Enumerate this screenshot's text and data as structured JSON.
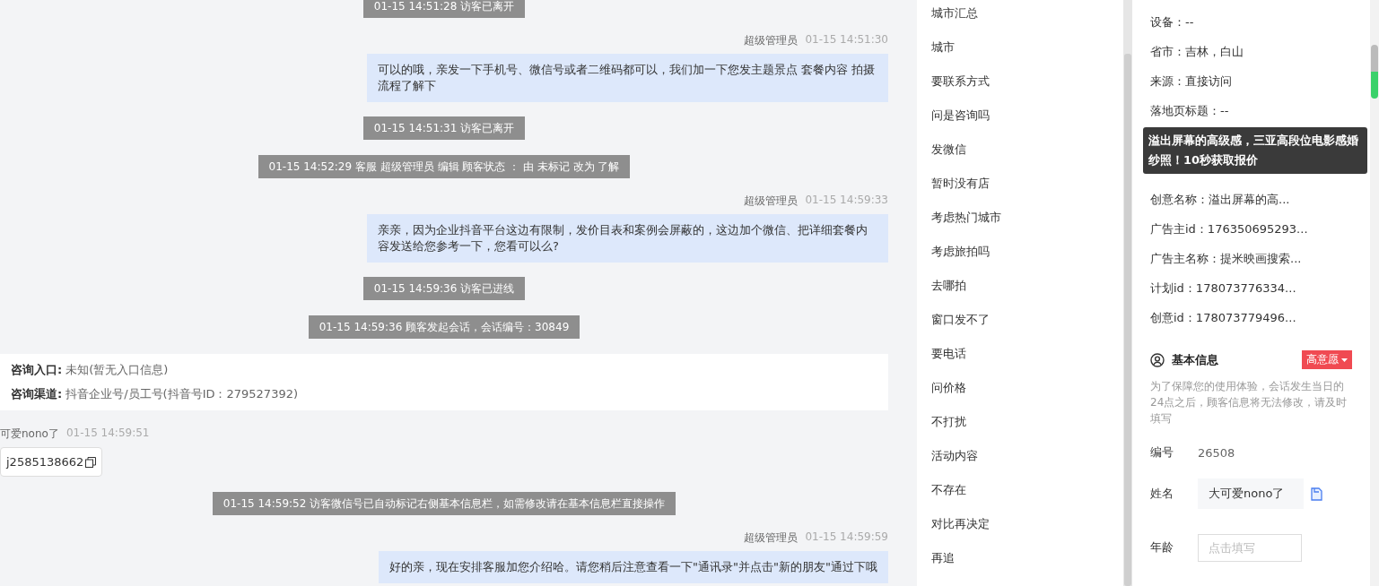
{
  "chat": {
    "messages": [
      {
        "kind": "system",
        "text": "01-15 14:51:28 访客已离开"
      },
      {
        "kind": "agent",
        "sender": "超级管理员",
        "time": "01-15 14:51:30",
        "text": "可以的哦，亲发一下手机号、微信号或者二维码都可以，我们加一下您发主题景点 套餐内容 拍摄流程了解下"
      },
      {
        "kind": "system",
        "text": "01-15 14:51:31 访客已离开"
      },
      {
        "kind": "system",
        "text": "01-15 14:52:29 客服 超级管理员 编辑 顾客状态 ： 由 未标记 改为 了解"
      },
      {
        "kind": "agent",
        "sender": "超级管理员",
        "time": "01-15 14:59:33",
        "text": "亲亲，因为企业抖音平台这边有限制，发价目表和案例会屏蔽的，这边加个微信、把详细套餐内容发送给您参考一下，您看可以么?"
      },
      {
        "kind": "system",
        "text": "01-15 14:59:36 访客已进线"
      },
      {
        "kind": "system",
        "text": "01-15 14:59:36 顾客发起会话，会话编号：30849"
      },
      {
        "kind": "info",
        "rows": [
          {
            "label": "咨询入口:",
            "value": "未知(暂无入口信息)"
          },
          {
            "label": "咨询渠道:",
            "value": "抖音企业号/员工号(抖音号ID：279527392)"
          }
        ]
      },
      {
        "kind": "visitor",
        "sender": "可爱nono了",
        "time": "01-15 14:59:51",
        "text": "j2585138662"
      },
      {
        "kind": "system",
        "text": "01-15 14:59:52 访客微信号已自动标记右侧基本信息栏，如需修改请在基本信息栏直接操作"
      },
      {
        "kind": "agent",
        "sender": "超级管理员",
        "time": "01-15 14:59:59",
        "text": "好的亲，现在安排客服加您介绍哈。请您稍后注意查看一下\"通讯录\"并点击\"新的朋友\"通过下哦"
      }
    ]
  },
  "tags": [
    "城市汇总",
    "城市",
    "要联系方式",
    "问是咨询吗",
    "发微信",
    "暂时没有店",
    "考虑热门城市",
    "考虑旅拍吗",
    "去哪拍",
    "窗口发不了",
    "要电话",
    "问价格",
    "不打扰",
    "活动内容",
    "不存在",
    "对比再决定",
    "再追"
  ],
  "visitor_info": {
    "rows_top": [
      "设备：--",
      "省市：吉林，白山",
      "来源：直接访问",
      "落地页标题：--"
    ],
    "tooltip": "溢出屏幕的高级感，三亚高段位电影感婚纱照！10秒获取报价",
    "rows_bottom": [
      "创意名称：溢出屏幕的高...",
      "广告主id：176350695293...",
      "广告主名称：提米映画搜索...",
      "计划id：178073776334...",
      "创意id：178073779496..."
    ]
  },
  "basic_info": {
    "title": "基本信息",
    "badge": "高意愿",
    "note": "为了保障您的使用体验，会话发生当日的24点之后，顾客信息将无法修改，请及时填写",
    "fields": [
      {
        "kind": "text",
        "label": "编号",
        "value": "26508"
      },
      {
        "kind": "copy",
        "label": "姓名",
        "value": "大可爱nono了"
      },
      {
        "kind": "input",
        "label": "年龄",
        "placeholder": "点击填写"
      }
    ]
  }
}
